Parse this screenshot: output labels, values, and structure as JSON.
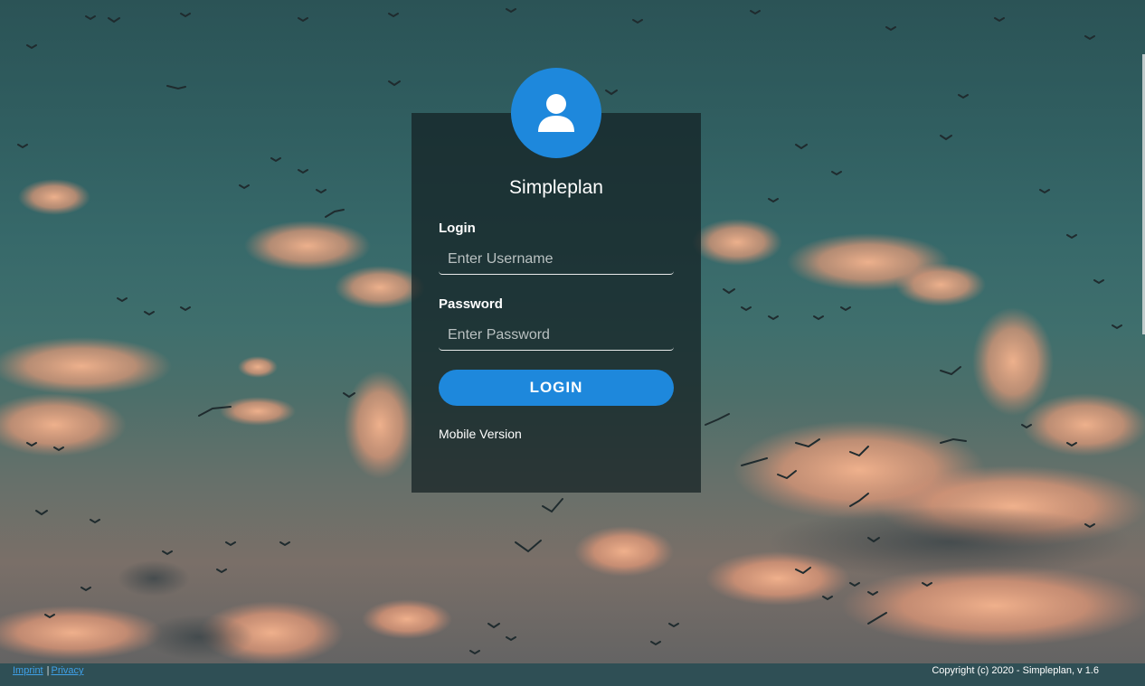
{
  "app": {
    "title": "Simpleplan"
  },
  "login_form": {
    "username_label": "Login",
    "username_placeholder": "Enter Username",
    "username_value": "",
    "password_label": "Password",
    "password_placeholder": "Enter Password",
    "password_value": "",
    "submit_label": "LOGIN",
    "mobile_link": "Mobile Version"
  },
  "footer": {
    "imprint": "Imprint",
    "separator": "|",
    "privacy": "Privacy",
    "copyright": "Copyright (c) 2020 - Simpleplan, v 1.6"
  },
  "icons": {
    "avatar": "user-icon"
  },
  "colors": {
    "accent": "#1e88dc",
    "panel": "rgba(20,32,34,0.72)",
    "footer_bg": "#2f4f55",
    "link": "#3fa0e8"
  }
}
